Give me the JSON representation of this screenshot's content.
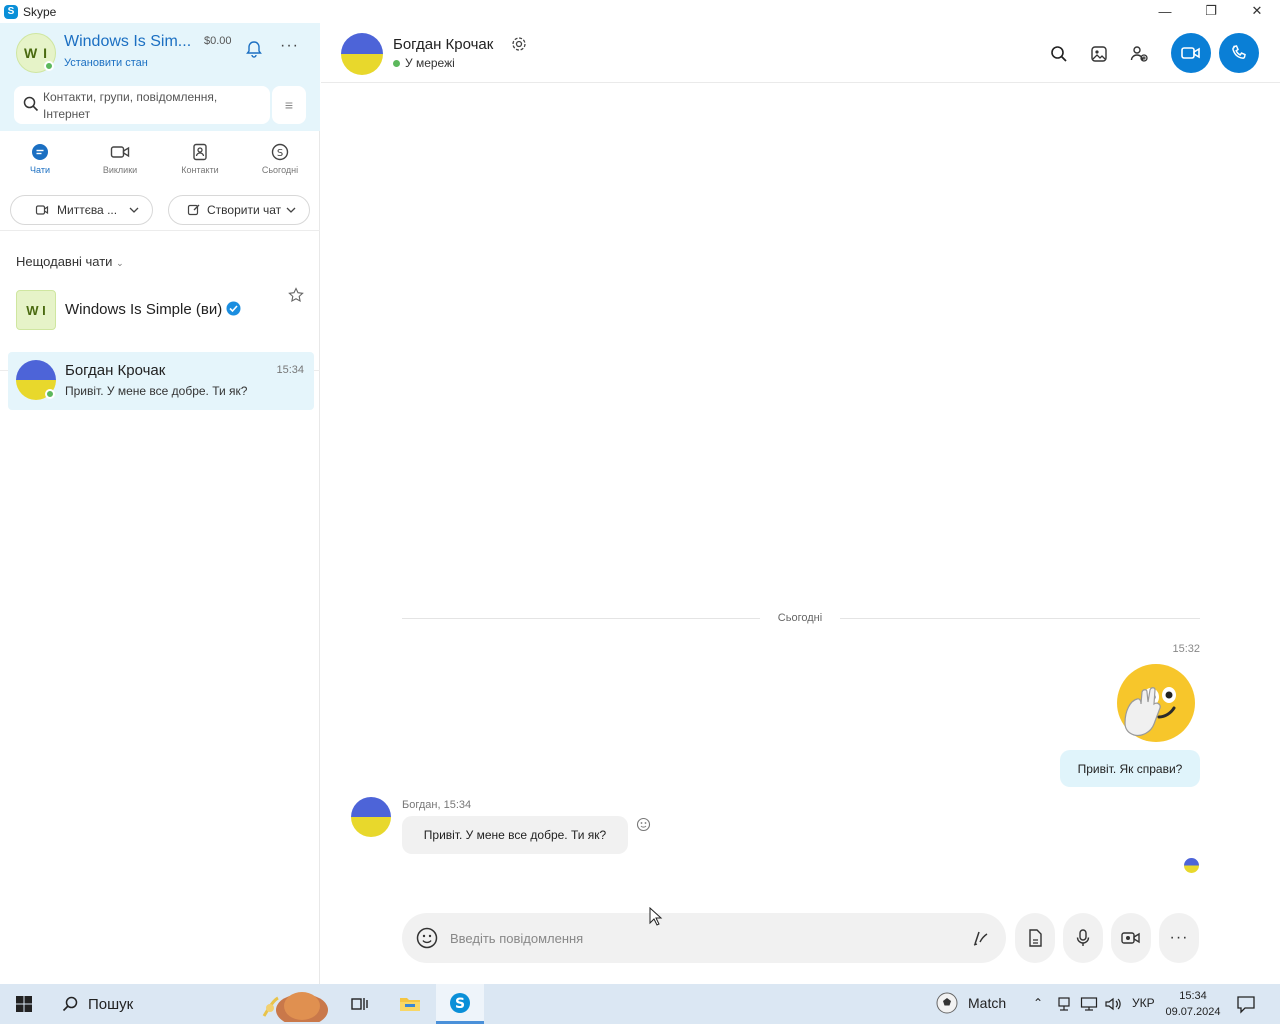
{
  "window": {
    "title": "Skype",
    "controls": [
      "minimize",
      "restore",
      "close"
    ]
  },
  "profile": {
    "initials": "W I",
    "name": "Windows Is Sim...",
    "credit": "$0.00",
    "status": "Установити стан"
  },
  "search": {
    "placeholder": "Контакти, групи, повідомлення, Інтернет"
  },
  "nav": {
    "tabs": [
      {
        "label": "Чати",
        "icon": "chat-icon",
        "active": true
      },
      {
        "label": "Виклики",
        "icon": "video-call-icon",
        "active": false
      },
      {
        "label": "Контакти",
        "icon": "contacts-icon",
        "active": false
      },
      {
        "label": "Сьогодні",
        "icon": "skype-today-icon",
        "active": false
      }
    ]
  },
  "actions": {
    "meet_now": "Миттєва ...",
    "new_chat": "Створити чат"
  },
  "recent": {
    "label": "Нещодавні чати",
    "items": [
      {
        "initials": "W I",
        "name": "Windows Is Simple (ви)",
        "verified": true
      },
      {
        "name": "Богдан Крочак",
        "time": "15:34",
        "preview": "Привіт. У мене все добре. Ти як?",
        "online": true
      }
    ]
  },
  "conversation": {
    "contact_name": "Богдан Крочак",
    "contact_status": "У мережі",
    "day_separator": "Сьогодні",
    "messages": [
      {
        "direction": "out",
        "time": "15:32",
        "emoji": "hand-over-mouth-emoji",
        "text": "Привіт. Як справи?"
      },
      {
        "direction": "in",
        "meta": "Богдан, 15:34",
        "text": "Привіт. У мене все добре. Ти як?"
      }
    ],
    "composer_placeholder": "Введіть повідомлення"
  },
  "taskbar": {
    "search_label": "Пошук",
    "weather_label": "Match",
    "language": "УКР",
    "time": "15:34",
    "date": "09.07.2024"
  },
  "colors": {
    "accent": "#0a7fd6",
    "sidebar_header": "#e5f5fb",
    "online": "#5cb85c",
    "taskbar": "#dbe7f3"
  }
}
